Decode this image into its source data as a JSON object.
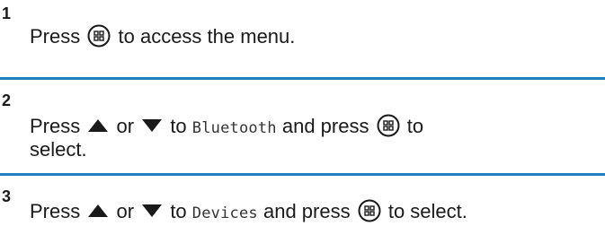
{
  "steps": [
    {
      "number": "1",
      "t1": "Press",
      "t2": "to access the menu."
    },
    {
      "number": "2",
      "t1": "Press",
      "t2": "or",
      "t3": "to",
      "menu_item": "Bluetooth",
      "t4": "and press",
      "t5": "to",
      "line2": "select."
    },
    {
      "number": "3",
      "t1": "Press",
      "t2": "or",
      "t3": "to",
      "menu_item": "Devices",
      "t4": "and press",
      "t5": "to select."
    }
  ],
  "icons": {
    "menu_ok": "menu-ok-button-icon",
    "up": "up-arrow-icon",
    "down": "down-arrow-icon"
  },
  "colors": {
    "divider": "#1f7fbf",
    "text": "#1a1a1a"
  }
}
